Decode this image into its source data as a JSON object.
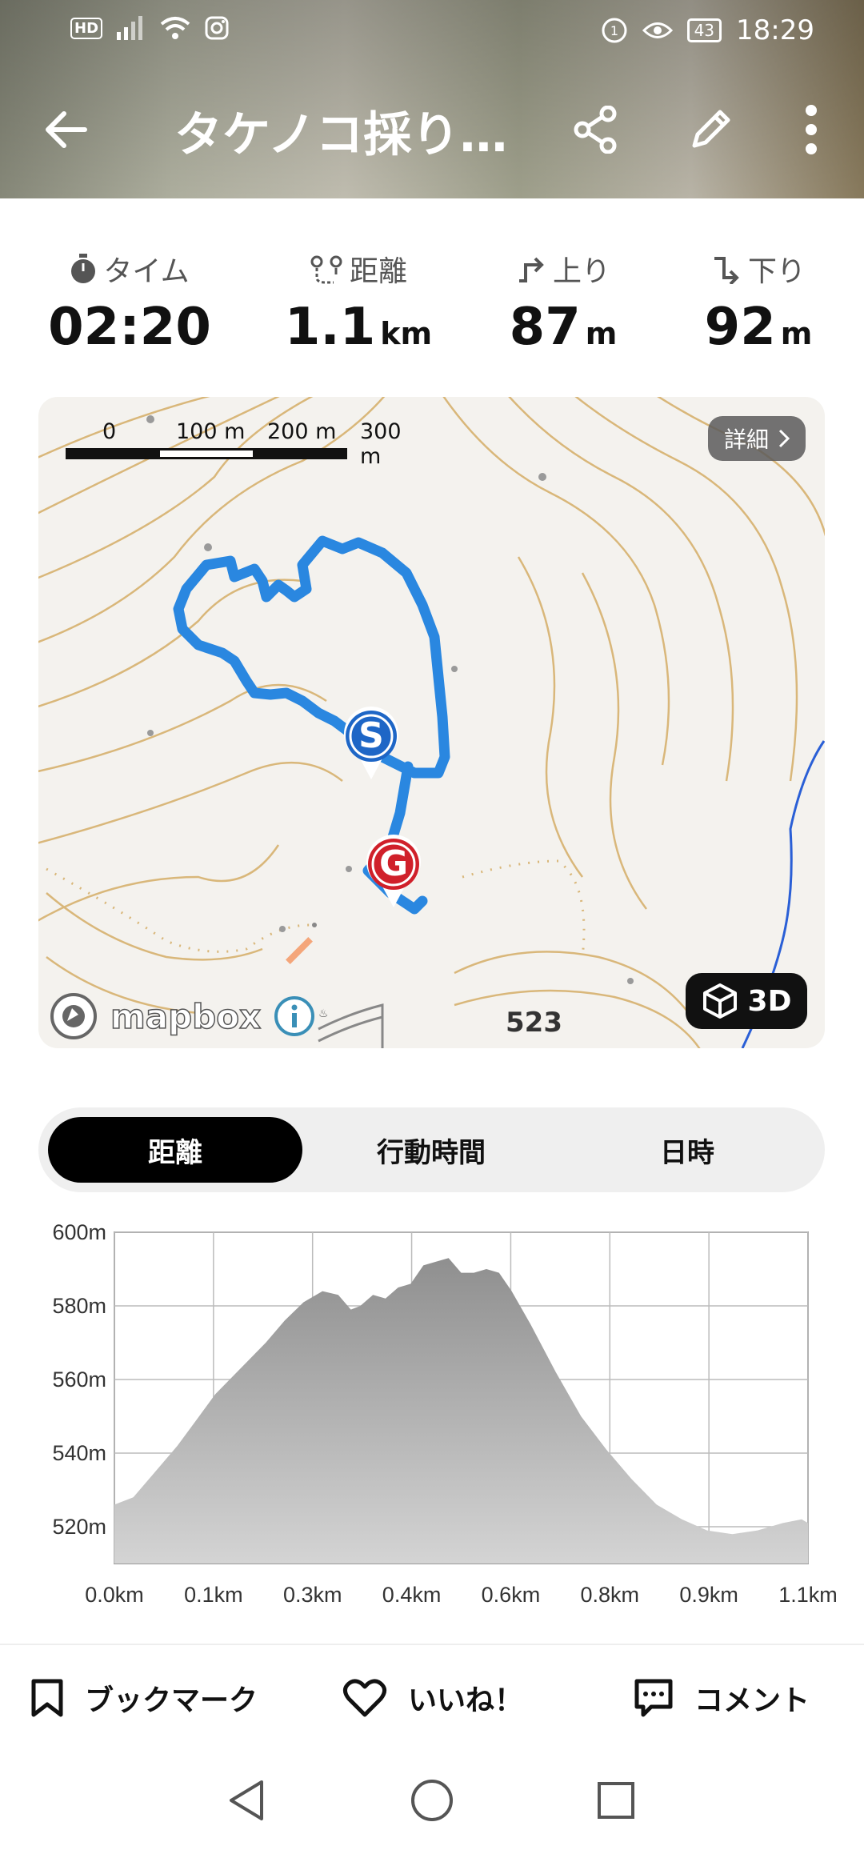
{
  "statusbar": {
    "hd": "HD",
    "battery": "43",
    "time": "18:29"
  },
  "appbar": {
    "title": "タケノコ採り…"
  },
  "stats": [
    {
      "label": "タイム",
      "value": "02:20",
      "unit": "",
      "icon": "stopwatch-icon"
    },
    {
      "label": "距離",
      "value": "1.1",
      "unit": "km",
      "icon": "route-pin-icon"
    },
    {
      "label": "上り",
      "value": "87",
      "unit": "m",
      "icon": "ascent-arrow-icon"
    },
    {
      "label": "下り",
      "value": "92",
      "unit": "m",
      "icon": "descent-arrow-icon"
    }
  ],
  "map": {
    "scale_labels": [
      "0",
      "100 m",
      "200 m",
      "300 m"
    ],
    "detail_button": "詳細",
    "attribution": "mapbox",
    "three_d_button": "3D",
    "elevation_point": "523",
    "start_marker": "S",
    "goal_marker": "G",
    "route_color": "#2a87e0"
  },
  "segments": [
    {
      "label": "距離",
      "active": true
    },
    {
      "label": "行動時間",
      "active": false
    },
    {
      "label": "日時",
      "active": false
    }
  ],
  "chart_data": {
    "type": "area",
    "x_tick_labels": [
      "0.0km",
      "0.1km",
      "0.3km",
      "0.4km",
      "0.6km",
      "0.8km",
      "0.9km",
      "1.1km"
    ],
    "y_tick_labels": [
      "600m",
      "580m",
      "560m",
      "540m",
      "520m"
    ],
    "ylim": [
      510,
      600
    ],
    "xlim": [
      0,
      1.1
    ],
    "grid": true,
    "x": [
      0.0,
      0.03,
      0.06,
      0.1,
      0.13,
      0.16,
      0.2,
      0.24,
      0.27,
      0.3,
      0.33,
      0.355,
      0.375,
      0.39,
      0.41,
      0.43,
      0.45,
      0.47,
      0.49,
      0.51,
      0.53,
      0.55,
      0.57,
      0.59,
      0.61,
      0.63,
      0.66,
      0.7,
      0.74,
      0.78,
      0.82,
      0.86,
      0.9,
      0.94,
      0.98,
      1.02,
      1.06,
      1.09,
      1.1
    ],
    "y": [
      526,
      528,
      534,
      542,
      549,
      556,
      563,
      570,
      576,
      581,
      584,
      583,
      579,
      580,
      583,
      582,
      585,
      586,
      591,
      592,
      593,
      589,
      589,
      590,
      589,
      584,
      575,
      562,
      550,
      541,
      533,
      526,
      522,
      519,
      518,
      519,
      521,
      522,
      521
    ]
  },
  "bottom_actions": [
    {
      "label": "ブックマーク",
      "icon": "bookmark-icon"
    },
    {
      "label": "いいね！",
      "icon": "heart-icon"
    },
    {
      "label": "コメント",
      "icon": "comment-icon"
    }
  ]
}
